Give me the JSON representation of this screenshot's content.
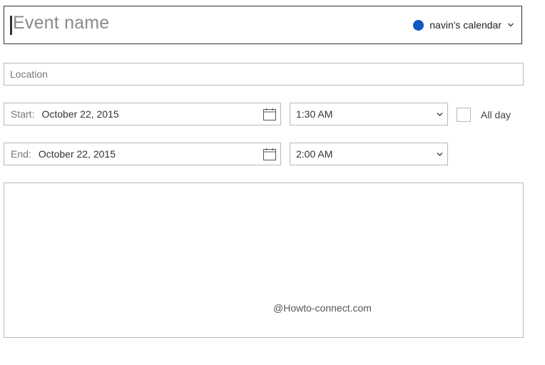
{
  "event": {
    "name_placeholder": "Event name",
    "calendar_label": "navin's calendar",
    "calendar_color": "#1058c4"
  },
  "location": {
    "placeholder": "Location"
  },
  "start": {
    "label": "Start:",
    "date": "October 22, 2015",
    "time": "1:30 AM"
  },
  "end": {
    "label": "End:",
    "date": "October 22, 2015",
    "time": "2:00 AM"
  },
  "all_day": {
    "label": "All day",
    "checked": false
  },
  "watermark": "@Howto-connect.com",
  "icons": {
    "calendar_picker": "chevron-down-icon",
    "date_picker": "calendar-icon",
    "time_picker": "chevron-down-icon"
  }
}
